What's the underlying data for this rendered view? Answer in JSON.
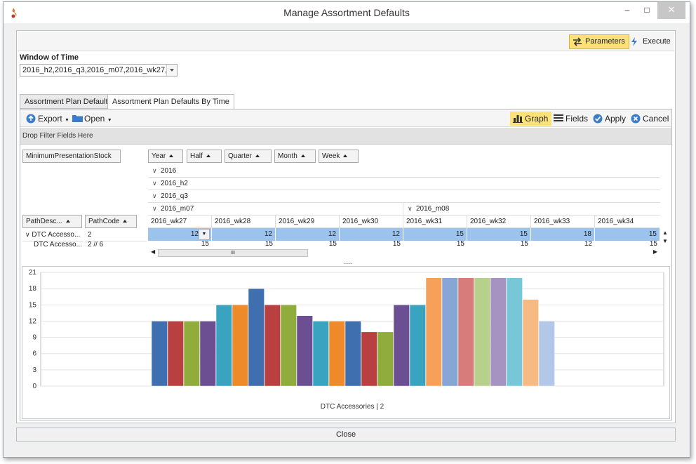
{
  "window": {
    "title": "Manage Assortment Defaults",
    "close_label": "Close"
  },
  "toolbar": {
    "parameters_label": "Parameters",
    "execute_label": "Execute"
  },
  "window_of_time": {
    "label": "Window of Time",
    "value": "2016_h2,2016_q3,2016_m07,2016_wk27,..."
  },
  "tabs": [
    {
      "label": "Assortment Plan Defaults",
      "active": false
    },
    {
      "label": "Assortment Plan Defaults By Time",
      "active": true
    }
  ],
  "grid_toolbar": {
    "export_label": "Export",
    "open_label": "Open",
    "graph_label": "Graph",
    "fields_label": "Fields",
    "apply_label": "Apply",
    "cancel_label": "Cancel"
  },
  "filter_area": {
    "label": "Drop Filter Fields Here"
  },
  "data_field": "MinimumPresentationStock",
  "column_fields": [
    "Year",
    "Half",
    "Quarter",
    "Month",
    "Week"
  ],
  "row_fields": [
    "PathDesc...",
    "PathCode"
  ],
  "column_headers": {
    "year": "2016",
    "half": "2016_h2",
    "quarter": "2016_q3",
    "months": [
      "2016_m07",
      "2016_m08"
    ],
    "weeks": [
      "2016_wk27",
      "2016_wk28",
      "2016_wk29",
      "2016_wk30",
      "2016_wk31",
      "2016_wk32",
      "2016_wk33",
      "2016_wk34"
    ]
  },
  "rows": [
    {
      "desc": "DTC Accesso...",
      "code": "2",
      "values": [
        "12",
        "12",
        "12",
        "12",
        "15",
        "15",
        "18",
        "15"
      ]
    },
    {
      "desc": "DTC Accesso...",
      "code": "2 // 6",
      "values": [
        "15",
        "15",
        "15",
        "15",
        "15",
        "15",
        "12",
        "15"
      ]
    }
  ],
  "scroll": {
    "thumb_glyph": "III",
    "splitter_glyph": "....."
  },
  "colors": {
    "selected_row": "#9cc3eb",
    "toggle_active": "#fde27a",
    "accent_blue": "#3d7bc8"
  },
  "chart_data": {
    "type": "bar",
    "xlabel": "DTC Accessories | 2",
    "ylim": [
      0,
      21
    ],
    "yticks": [
      0,
      3,
      6,
      9,
      12,
      15,
      18,
      21
    ],
    "grid": true,
    "series": [
      {
        "values": [
          12,
          12,
          12,
          12,
          15,
          15,
          18,
          15,
          15,
          13,
          12,
          12,
          12,
          10,
          10,
          15,
          15,
          20,
          20,
          20,
          20,
          20,
          20,
          16,
          12
        ]
      }
    ],
    "bar_colors": [
      "#3f6faf",
      "#b84040",
      "#8fac3d",
      "#6c4f93",
      "#3aa3bf",
      "#ef8a2a",
      "#3f6faf",
      "#b84040",
      "#8fac3d",
      "#6c4f93",
      "#3aa3bf",
      "#ef8a2a",
      "#3f6faf",
      "#b84040",
      "#8fac3d",
      "#6c4f93",
      "#3aa3bf",
      "#f6a05a",
      "#86a6d3",
      "#d87b7b",
      "#b7d08c",
      "#a793c2",
      "#78c7d9",
      "#f6ba82",
      "#b3c8e8"
    ]
  }
}
